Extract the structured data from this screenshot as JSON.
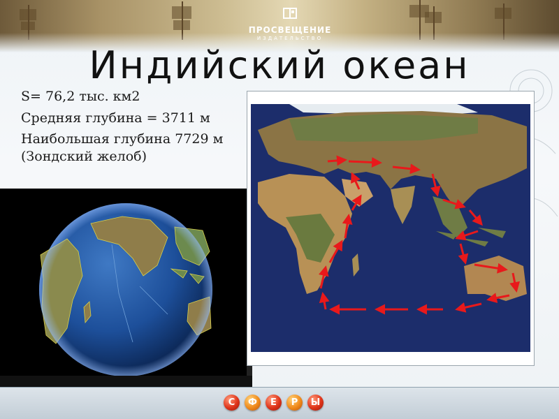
{
  "publisher": {
    "name": "ПРОСВЕЩЕНИЕ",
    "sub": "ИЗДАТЕЛЬСТВО"
  },
  "slide": {
    "title": "Индийский океан",
    "facts": [
      "S= 76,2 тыс. км2",
      "Средняя глубина = 3711 м",
      "Наибольшая глубина 7729 м (Зондский желоб)"
    ]
  },
  "footer": {
    "spheres": [
      "С",
      "Ф",
      "Е",
      "Р",
      "Ы"
    ]
  },
  "colors": {
    "arrow": "#e8191b",
    "ocean": "#1c2d6b",
    "globe_ocean": "#1d4f9a",
    "land": "#b48a4a"
  }
}
